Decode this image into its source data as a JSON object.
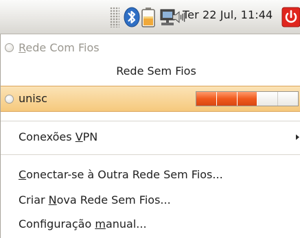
{
  "panel": {
    "clock": "Ter 22 Jul, 11:44",
    "icons": [
      "bluetooth-icon",
      "battery-icon",
      "network-icon",
      "volume-icon",
      "power-icon"
    ]
  },
  "menu": {
    "wired": {
      "label_mnemonic": "R",
      "label_rest": "ede Com Fios"
    },
    "wireless_header": "Rede Sem Fios",
    "network": {
      "name": "unisc",
      "signal_fraction": 0.6,
      "signal_segments": 5
    },
    "vpn": {
      "before": "Conexões ",
      "mnemonic": "V",
      "after": "PN"
    },
    "connect_other": {
      "mnemonic": "C",
      "rest": "onectar-se à Outra Rede Sem Fios..."
    },
    "create_new": {
      "before": "Criar ",
      "mnemonic": "N",
      "after": "ova Rede Sem Fios..."
    },
    "manual_config": {
      "before": "Configuração ",
      "mnemonic": "m",
      "after": "anual..."
    }
  },
  "colors": {
    "highlight": "#f6c97d",
    "signal_on": "#ef5a1e",
    "panel_bg": "#ecebe8"
  }
}
